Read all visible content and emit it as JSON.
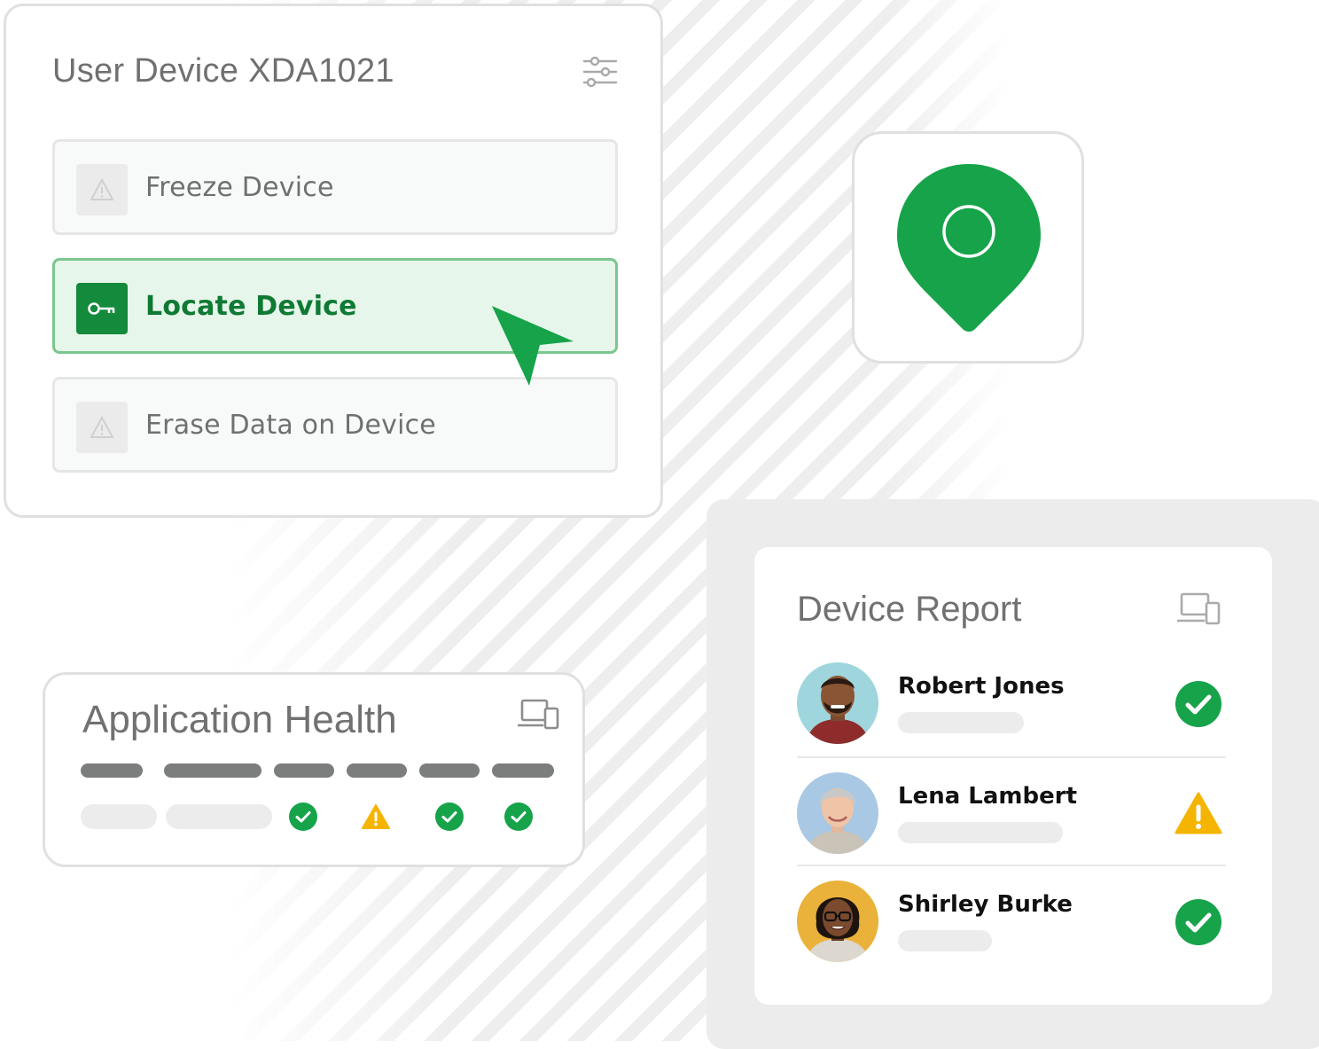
{
  "device_panel": {
    "title": "User Device XDA1021",
    "actions": [
      {
        "label": "Freeze Device",
        "state": "disabled",
        "icon": "warning-icon"
      },
      {
        "label": "Locate Device",
        "state": "selected",
        "icon": "key-icon"
      },
      {
        "label": "Erase Data on Device",
        "state": "disabled",
        "icon": "warning-icon"
      }
    ]
  },
  "location": {
    "icon": "map-pin-icon"
  },
  "health": {
    "title": "Application Health",
    "statuses": [
      "ok",
      "warning",
      "ok",
      "ok"
    ]
  },
  "report": {
    "title": "Device Report",
    "users": [
      {
        "name": "Robert Jones",
        "status": "ok"
      },
      {
        "name": "Lena Lambert",
        "status": "warning"
      },
      {
        "name": "Shirley Burke",
        "status": "ok"
      }
    ]
  },
  "colors": {
    "accent_green": "#16a34a",
    "dark_green": "#138a3c",
    "warning_yellow": "#f5b400",
    "text_gray": "#6f7071"
  }
}
